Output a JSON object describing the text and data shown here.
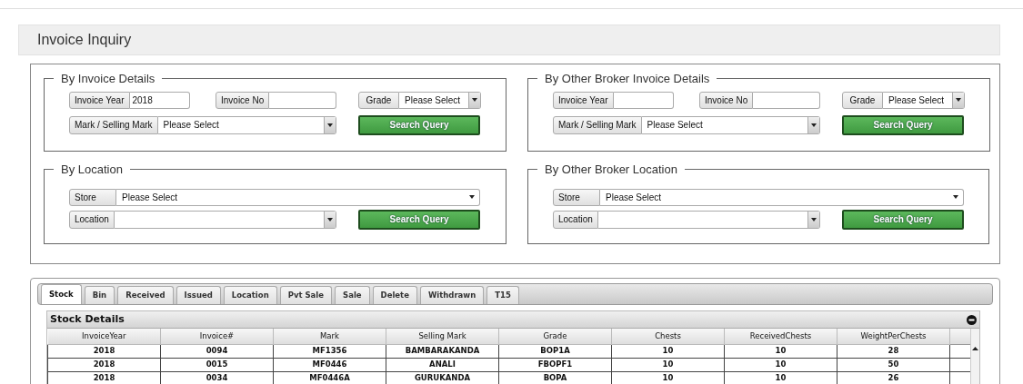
{
  "page_title": "Invoice Inquiry",
  "panels": [
    {
      "kind": "invoice",
      "legend": "By Invoice Details",
      "invoice_year": {
        "label": "Invoice Year",
        "value": "2018"
      },
      "invoice_no": {
        "label": "Invoice No"
      },
      "grade": {
        "label": "Grade",
        "value": "Please Select"
      },
      "mark": {
        "label": "Mark / Selling Mark",
        "value": "Please Select"
      },
      "button": "Search Query"
    },
    {
      "kind": "invoice",
      "legend": "By Other Broker Invoice Details",
      "invoice_year": {
        "label": "Invoice Year"
      },
      "invoice_no": {
        "label": "Invoice No"
      },
      "grade": {
        "label": "Grade",
        "value": "Please Select"
      },
      "mark": {
        "label": "Mark / Selling Mark",
        "value": "Please Select"
      },
      "button": "Search Query"
    },
    {
      "kind": "location",
      "legend": "By Location",
      "store": {
        "label": "Store",
        "value": "Please Select"
      },
      "location": {
        "label": "Location"
      },
      "button": "Search Query"
    },
    {
      "kind": "location",
      "legend": "By Other Broker Location",
      "store": {
        "label": "Store",
        "value": "Please Select"
      },
      "location": {
        "label": "Location"
      },
      "button": "Search Query"
    }
  ],
  "tabs": [
    {
      "label": "Stock",
      "selected": true
    },
    {
      "label": "Bin",
      "selected": false
    },
    {
      "label": "Received",
      "selected": false
    },
    {
      "label": "Issued",
      "selected": false
    },
    {
      "label": "Location",
      "selected": false
    },
    {
      "label": "Pvt Sale",
      "selected": false
    },
    {
      "label": "Sale",
      "selected": false
    },
    {
      "label": "Delete",
      "selected": false
    },
    {
      "label": "Withdrawn",
      "selected": false
    },
    {
      "label": "T15",
      "selected": false
    }
  ],
  "table": {
    "title": "Stock Details",
    "columns": [
      "InvoiceYear",
      "Invoice#",
      "Mark",
      "Selling Mark",
      "Grade",
      "Chests",
      "ReceivedChests",
      "WeightPerChests"
    ],
    "rows": [
      [
        "2018",
        "0094",
        "MF1356",
        "BAMBARAKANDA",
        "BOP1A",
        "10",
        "10",
        "28"
      ],
      [
        "2018",
        "0015",
        "MF0446",
        "ANALI",
        "FBOPF1",
        "10",
        "10",
        "50"
      ],
      [
        "2018",
        "0034",
        "MF0446A",
        "GURUKANDA",
        "BOPA",
        "10",
        "10",
        "26"
      ]
    ]
  }
}
